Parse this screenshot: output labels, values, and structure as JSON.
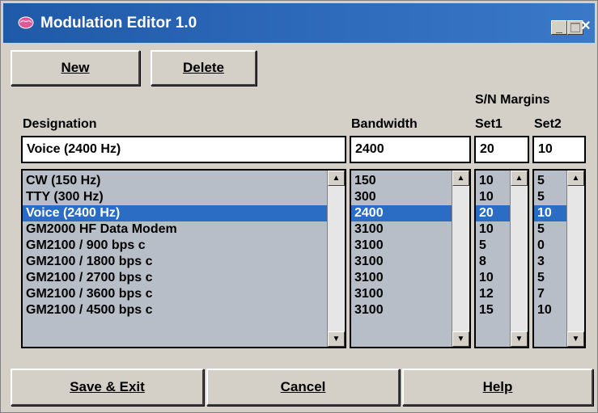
{
  "window": {
    "title": "Modulation Editor 1.0",
    "controls": {
      "minimize": "_",
      "close": "×"
    }
  },
  "toolbar": {
    "new_label": "New",
    "delete_label": "Delete"
  },
  "headers": {
    "sn_margins": "S/N Margins",
    "designation": "Designation",
    "bandwidth": "Bandwidth",
    "set1": "Set1",
    "set2": "Set2"
  },
  "fields": {
    "designation": "Voice   (2400 Hz)",
    "bandwidth": "2400",
    "set1": "20",
    "set2": "10"
  },
  "list": {
    "selected_index": 2,
    "designation": [
      "CW    (150 Hz)",
      "TTY   (300 Hz)",
      "Voice   (2400 Hz)",
      "GM2000 HF Data Modem",
      "GM2100 / 900 bps c",
      "GM2100 / 1800 bps c",
      "GM2100 / 2700 bps c",
      "GM2100 / 3600 bps c",
      "GM2100 / 4500 bps c"
    ],
    "bandwidth": [
      "150",
      "300",
      "2400",
      "3100",
      "3100",
      "3100",
      "3100",
      "3100",
      "3100"
    ],
    "set1": [
      "10",
      "10",
      "20",
      "10",
      "5",
      "8",
      "10",
      "12",
      "15"
    ],
    "set2": [
      "5",
      "5",
      "10",
      "5",
      "0",
      "3",
      "5",
      "7",
      "10"
    ]
  },
  "footer": {
    "save_label": "Save & Exit",
    "cancel_label": "Cancel",
    "help_label": "Help"
  },
  "colors": {
    "titlebar": "#1f5aa8",
    "selection": "#2b6cc4",
    "list_bg": "#b8bec8",
    "dialog_bg": "#d4d0c8"
  },
  "icons": {
    "app": "brain-icon",
    "scroll_up": "arrow-up-icon",
    "scroll_down": "arrow-down-icon"
  }
}
